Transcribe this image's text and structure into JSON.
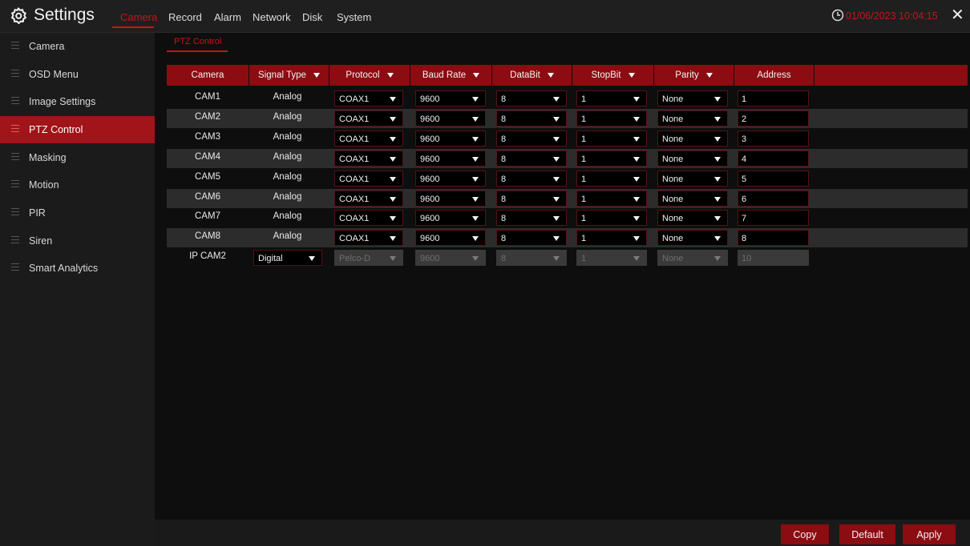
{
  "app": {
    "title": "Settings",
    "clock": "01/06/2023 10:04:15"
  },
  "menu": [
    "Camera",
    "Record",
    "Alarm",
    "Network",
    "Disk",
    "System"
  ],
  "sidebar": [
    "Camera",
    "OSD Menu",
    "Image Settings",
    "PTZ Control",
    "Masking",
    "Motion",
    "PIR",
    "Siren",
    "Smart Analytics"
  ],
  "sidebar_active": "PTZ Control",
  "subtab": "PTZ Control",
  "headers": [
    "Camera",
    "Signal Type",
    "Protocol",
    "Baud Rate",
    "DataBit",
    "StopBit",
    "Parity",
    "Address"
  ],
  "rows": [
    {
      "camera": "CAM1",
      "signal": "Analog",
      "protocol": "COAX1",
      "baud": "9600",
      "databit": "8",
      "stopbit": "1",
      "parity": "None",
      "address": "1"
    },
    {
      "camera": "CAM2",
      "signal": "Analog",
      "protocol": "COAX1",
      "baud": "9600",
      "databit": "8",
      "stopbit": "1",
      "parity": "None",
      "address": "2"
    },
    {
      "camera": "CAM3",
      "signal": "Analog",
      "protocol": "COAX1",
      "baud": "9600",
      "databit": "8",
      "stopbit": "1",
      "parity": "None",
      "address": "3"
    },
    {
      "camera": "CAM4",
      "signal": "Analog",
      "protocol": "COAX1",
      "baud": "9600",
      "databit": "8",
      "stopbit": "1",
      "parity": "None",
      "address": "4"
    },
    {
      "camera": "CAM5",
      "signal": "Analog",
      "protocol": "COAX1",
      "baud": "9600",
      "databit": "8",
      "stopbit": "1",
      "parity": "None",
      "address": "5"
    },
    {
      "camera": "CAM6",
      "signal": "Analog",
      "protocol": "COAX1",
      "baud": "9600",
      "databit": "8",
      "stopbit": "1",
      "parity": "None",
      "address": "6"
    },
    {
      "camera": "CAM7",
      "signal": "Analog",
      "protocol": "COAX1",
      "baud": "9600",
      "databit": "8",
      "stopbit": "1",
      "parity": "None",
      "address": "7"
    },
    {
      "camera": "CAM8",
      "signal": "Analog",
      "protocol": "COAX1",
      "baud": "9600",
      "databit": "8",
      "stopbit": "1",
      "parity": "None",
      "address": "8"
    },
    {
      "camera": "IP CAM2",
      "signal": "Digital",
      "protocol": "Pelco-D",
      "baud": "9600",
      "databit": "8",
      "stopbit": "1",
      "parity": "None",
      "address": "10"
    }
  ],
  "buttons": {
    "copy": "Copy",
    "default": "Default",
    "apply": "Apply"
  },
  "colors": {
    "accent": "#c4151c",
    "header": "#8b0c11"
  }
}
